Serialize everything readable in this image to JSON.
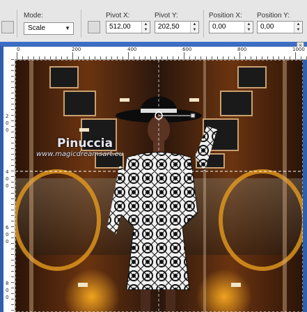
{
  "toolbar": {
    "mode_label": "Mode:",
    "mode_value": "Scale",
    "pivot_x_label": "Pivot X:",
    "pivot_x_value": "512,00",
    "pivot_y_label": "Pivot Y:",
    "pivot_y_value": "202,50",
    "position_x_label": "Position X:",
    "position_x_value": "0,00",
    "position_y_label": "Position Y:",
    "position_y_value": "0,00"
  },
  "ruler": {
    "h_labels": [
      "0",
      "200",
      "400",
      "600",
      "800",
      "1000"
    ],
    "v_labels": [
      "2",
      "0",
      "0",
      "4",
      "0",
      "0",
      "6",
      "0",
      "0",
      "8",
      "0",
      "0"
    ]
  },
  "canvas": {
    "watermark_main": "Pinuccia",
    "watermark_url": "www.magicdreamsart.eu"
  },
  "colors": {
    "toolbar_bg": "#e6e6e6",
    "window_frame": "#2f5fae",
    "canvas_bg": "#1a0d06"
  }
}
